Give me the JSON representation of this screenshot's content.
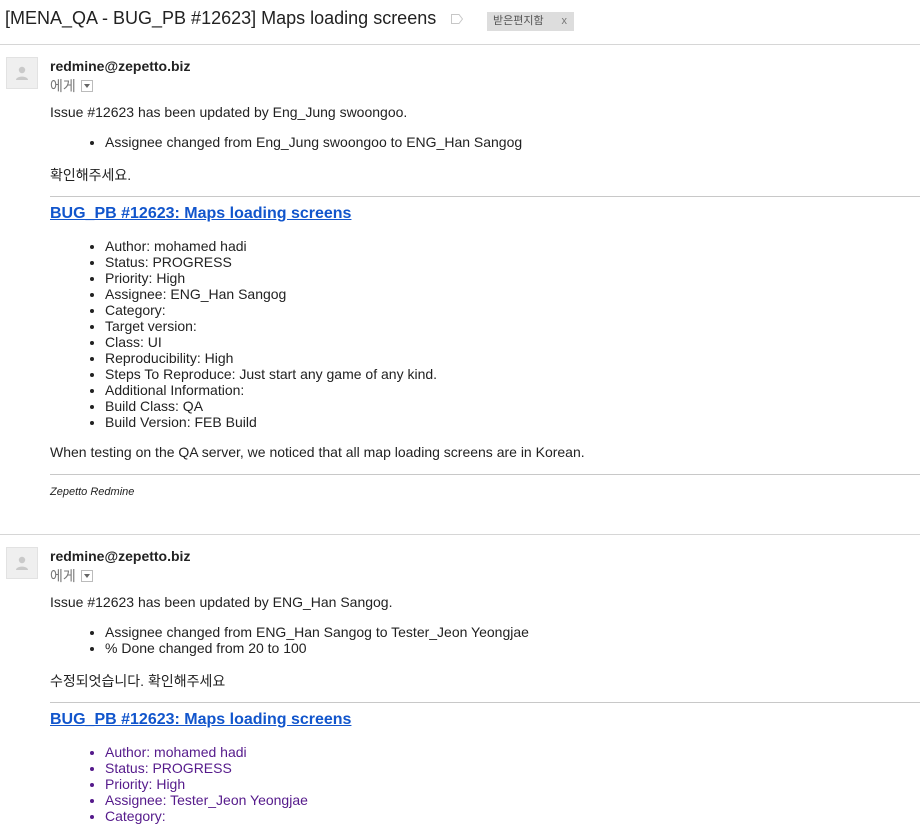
{
  "subject": "[MENA_QA - BUG_PB #12623] Maps loading screens",
  "inbox_label": "받은편지함",
  "inbox_label_remove": "x",
  "messages": [
    {
      "sender": "redmine@zepetto.biz",
      "to": "에게",
      "updated_line": "Issue #12623 has been updated by Eng_Jung swoongoo.",
      "changes": [
        "Assignee changed from Eng_Jung swoongoo to ENG_Han Sangog"
      ],
      "note": "확인해주세요.",
      "issue_link": "BUG_PB #12623: Maps loading screens",
      "details": [
        "Author: mohamed hadi",
        "Status: PROGRESS",
        "Priority: High",
        "Assignee: ENG_Han Sangog",
        "Category:",
        "Target version:",
        "Class: UI",
        "Reproducibility: High",
        "Steps To Reproduce: Just start any game of any kind.",
        "Additional Information:",
        "Build Class: QA",
        "Build Version: FEB Build"
      ],
      "description": "When testing on the QA server, we noticed that all map loading screens are in Korean.",
      "footer": "Zepetto Redmine"
    },
    {
      "sender": "redmine@zepetto.biz",
      "to": "에게",
      "updated_line": "Issue #12623 has been updated by ENG_Han Sangog.",
      "changes": [
        "Assignee changed from ENG_Han Sangog to Tester_Jeon Yeongjae",
        "% Done changed from 20 to 100"
      ],
      "note": "수정되엇습니다. 확인해주세요",
      "issue_link": "BUG_PB #12623: Maps loading screens",
      "details": [
        "Author: mohamed hadi",
        "Status: PROGRESS",
        "Priority: High",
        "Assignee: Tester_Jeon Yeongjae",
        "Category:"
      ]
    }
  ]
}
